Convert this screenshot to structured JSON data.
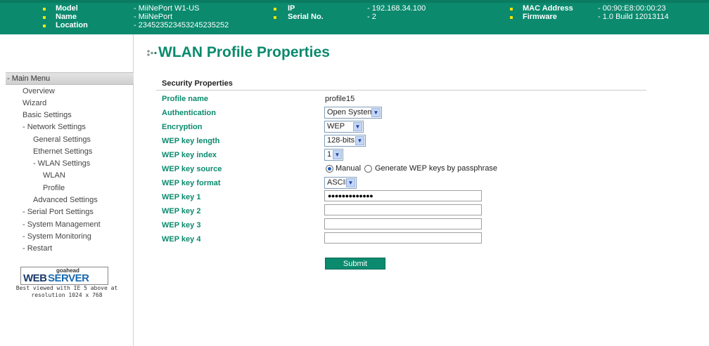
{
  "header": {
    "model_label": "Model",
    "model_value": "- MiiNePort W1-US",
    "name_label": "Name",
    "name_value": "- MiiNePort",
    "location_label": "Location",
    "location_value": "- 2345235234532452352­52",
    "ip_label": "IP",
    "ip_value": "- 192.168.34.100",
    "serial_label": "Serial No.",
    "serial_value": "- 2",
    "mac_label": "MAC Address",
    "mac_value": "- 00:90:E8:00:00:23",
    "firmware_label": "Firmware",
    "firmware_value": "- 1.0 Build 12013114"
  },
  "sidebar": {
    "menu_head": "- Main Menu",
    "items": [
      "Overview",
      "Wizard",
      "Basic Settings",
      "- Network Settings",
      "General Settings",
      "Ethernet Settings",
      "- WLAN Settings",
      "WLAN",
      "Profile",
      "Advanced Settings",
      "- Serial Port Settings",
      "- System Management",
      "- System Monitoring",
      "- Restart"
    ],
    "logo_small": "goahead",
    "logo_web": "WEB",
    "logo_server": "SERVER",
    "best_line1": "Best viewed with IE 5 above at",
    "best_line2": "resolution 1024 x 768"
  },
  "main": {
    "title": "WLAN Profile Properties",
    "section": "Security Properties",
    "fields": {
      "profile_name_label": "Profile name",
      "profile_name_value": "profile15",
      "authentication_label": "Authentication",
      "authentication_value": "Open System",
      "encryption_label": "Encryption",
      "encryption_value": "WEP",
      "key_length_label": "WEP key length",
      "key_length_value": "128-bits",
      "key_index_label": "WEP key index",
      "key_index_value": "1",
      "key_source_label": "WEP key source",
      "key_source_manual": "Manual",
      "key_source_passphrase": "Generate WEP keys by passphrase",
      "key_format_label": "WEP key format",
      "key_format_value": "ASCII",
      "key1_label": "WEP key 1",
      "key1_value": "●●●●●●●●●●●●●",
      "key2_label": "WEP key 2",
      "key2_value": "",
      "key3_label": "WEP key 3",
      "key3_value": "",
      "key4_label": "WEP key 4",
      "key4_value": ""
    },
    "submit_label": "Submit"
  },
  "colors": {
    "accent": "#0b8a6e",
    "bullet": "#f2e600"
  }
}
